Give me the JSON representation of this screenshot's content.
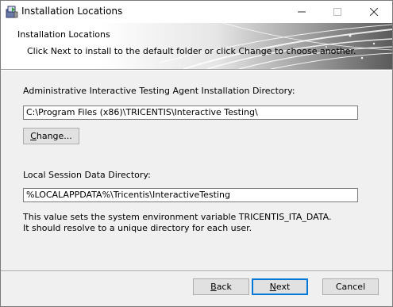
{
  "window": {
    "title": "Installation Locations"
  },
  "banner": {
    "heading": "Installation Locations",
    "subtitle": "Click Next to install to the default folder or click Change to choose another."
  },
  "install_dir": {
    "label": "Administrative Interactive Testing Agent Installation Directory:",
    "value": "C:\\Program Files (x86)\\TRICENTIS\\Interactive Testing\\",
    "change_button": {
      "mnemonic": "C",
      "rest": "hange..."
    }
  },
  "session_dir": {
    "label": "Local Session Data Directory:",
    "value": "%LOCALAPPDATA%\\Tricentis\\InteractiveTesting",
    "note_line1": "This value sets the system environment variable TRICENTIS_ITA_DATA.",
    "note_line2": "It should resolve to a unique directory for each user."
  },
  "footer": {
    "back": {
      "mnemonic": "B",
      "rest": "ack"
    },
    "next": {
      "mnemonic": "N",
      "rest": "ext"
    },
    "cancel": "Cancel"
  },
  "icons": [
    "installer-icon",
    "minimize-icon",
    "maximize-icon",
    "close-icon"
  ]
}
